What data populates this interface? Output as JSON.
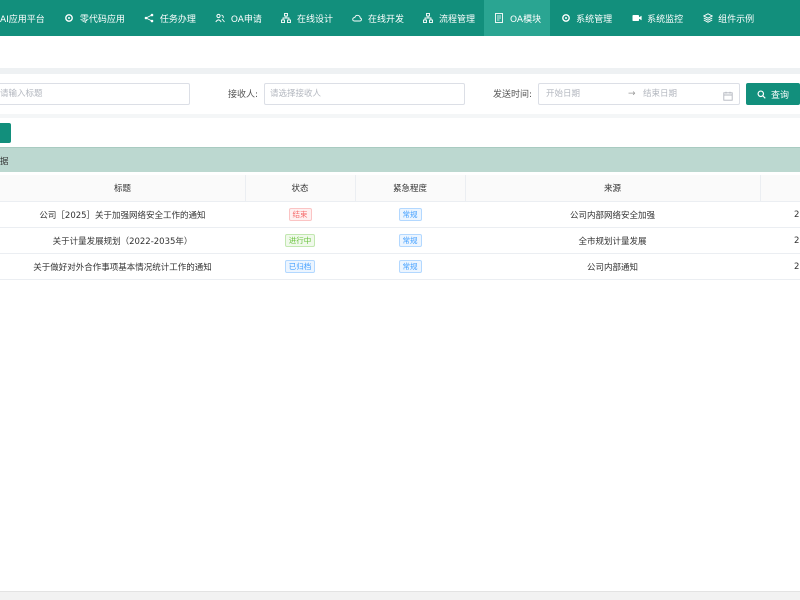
{
  "nav": {
    "items": [
      {
        "label": "AI应用平台",
        "icon": "none",
        "active": false
      },
      {
        "label": "零代码应用",
        "icon": "gear-icon",
        "active": false
      },
      {
        "label": "任务办理",
        "icon": "share-icon",
        "active": false
      },
      {
        "label": "OA申请",
        "icon": "users-icon",
        "active": false
      },
      {
        "label": "在线设计",
        "icon": "flow-icon",
        "active": false
      },
      {
        "label": "在线开发",
        "icon": "cloud-icon",
        "active": false
      },
      {
        "label": "流程管理",
        "icon": "flow-icon",
        "active": false
      },
      {
        "label": "OA模块",
        "icon": "document-icon",
        "active": true
      },
      {
        "label": "系统管理",
        "icon": "gear-icon",
        "active": false
      },
      {
        "label": "系统监控",
        "icon": "video-icon",
        "active": false
      },
      {
        "label": "组件示例",
        "icon": "layers-icon",
        "active": false
      }
    ]
  },
  "filters": {
    "title_placeholder": "请输入标题",
    "receiver_label": "接收人:",
    "receiver_placeholder": "请选择接收人",
    "time_label": "发送时间:",
    "start_placeholder": "开始日期",
    "range_separator": "→",
    "end_placeholder": "结束日期",
    "search_label": "查询"
  },
  "card": {
    "header": "据"
  },
  "table": {
    "columns": [
      "标题",
      "状态",
      "紧急程度",
      "来源"
    ],
    "rows": [
      {
        "title": "公司［2025］关于加强网络安全工作的通知",
        "status": "结束",
        "status_color": "red",
        "urgency": "常规",
        "source": "公司内部网络安全加强",
        "extra": "2"
      },
      {
        "title": "关于计量发展规划（2022-2035年）",
        "status": "进行中",
        "status_color": "green",
        "urgency": "常规",
        "source": "全市规划计量发展",
        "extra": "2"
      },
      {
        "title": "关于做好对外合作事项基本情况统计工作的通知",
        "status": "已归档",
        "status_color": "blue",
        "urgency": "常规",
        "source": "公司内部通知",
        "extra": "2"
      }
    ]
  },
  "colors": {
    "primary": "#128f7c",
    "active_nav": "#2aa592",
    "card_header": "#bcd8d0"
  }
}
